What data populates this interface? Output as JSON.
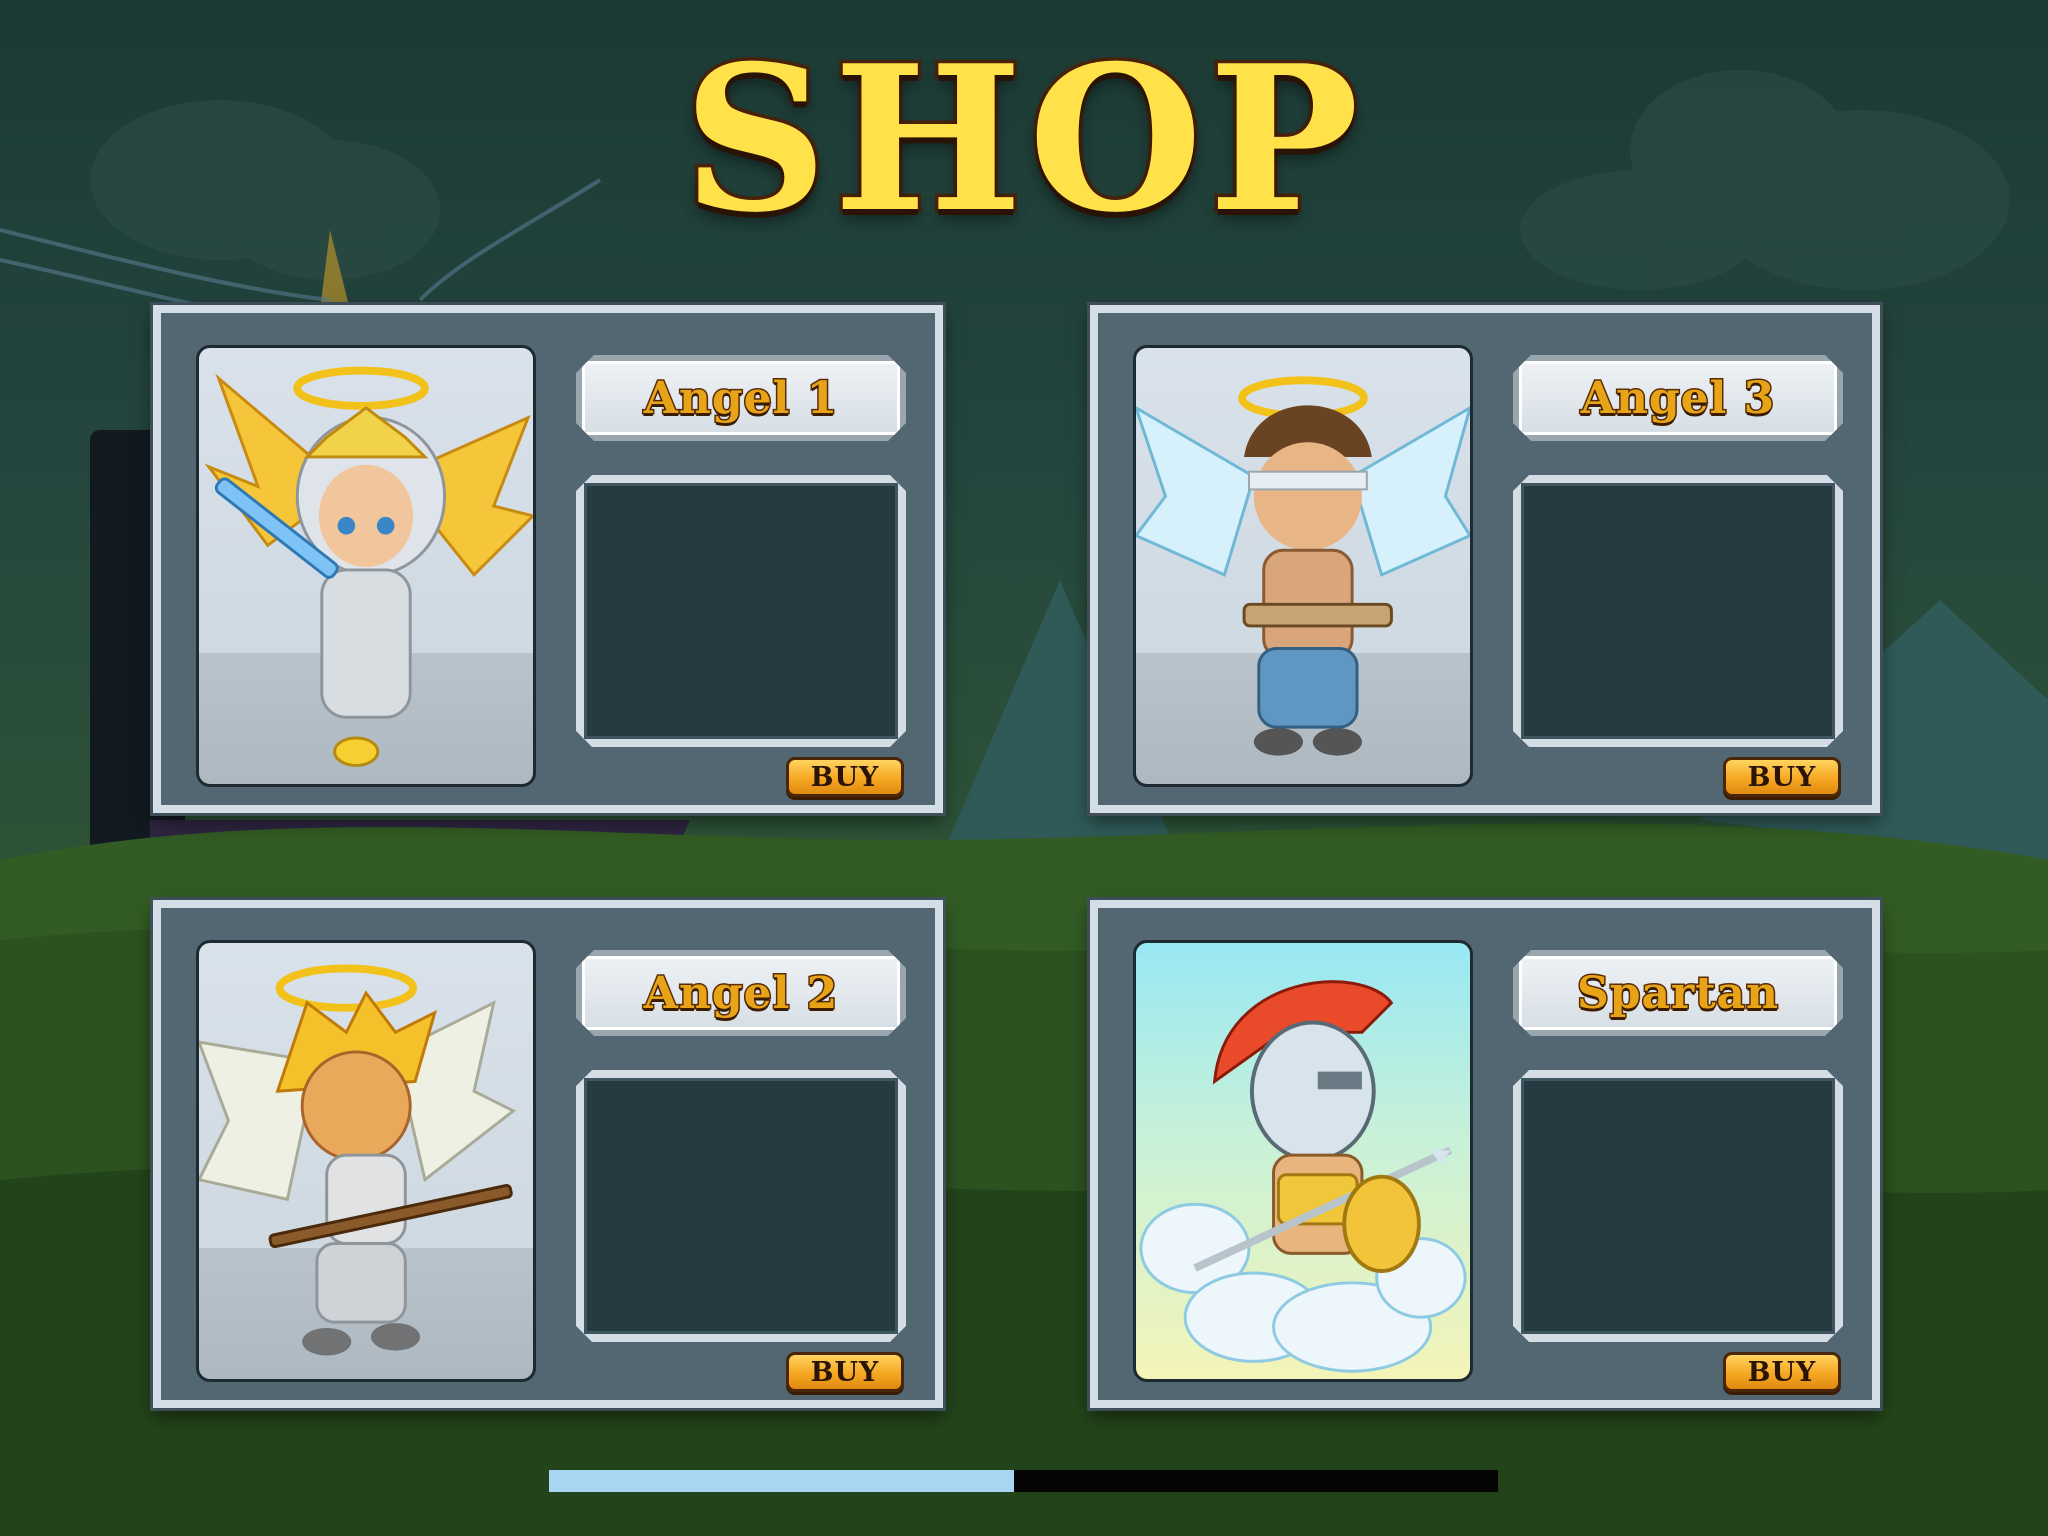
{
  "title": "SHOP",
  "products": [
    {
      "name": "Angel 1",
      "buy_label": "BUY"
    },
    {
      "name": "Angel 3",
      "buy_label": "BUY"
    },
    {
      "name": "Angel 2",
      "buy_label": "BUY"
    },
    {
      "name": "Spartan",
      "buy_label": "BUY"
    }
  ],
  "progress": {
    "fraction": 0.49
  },
  "colors": {
    "title": "#ffe24a",
    "panel": "#536773",
    "panel_border": "#d3dee6",
    "info_box": "#263a42",
    "buy_button": "#f5a722",
    "progress_fill": "#a8d6f2",
    "progress_track": "#050505"
  }
}
